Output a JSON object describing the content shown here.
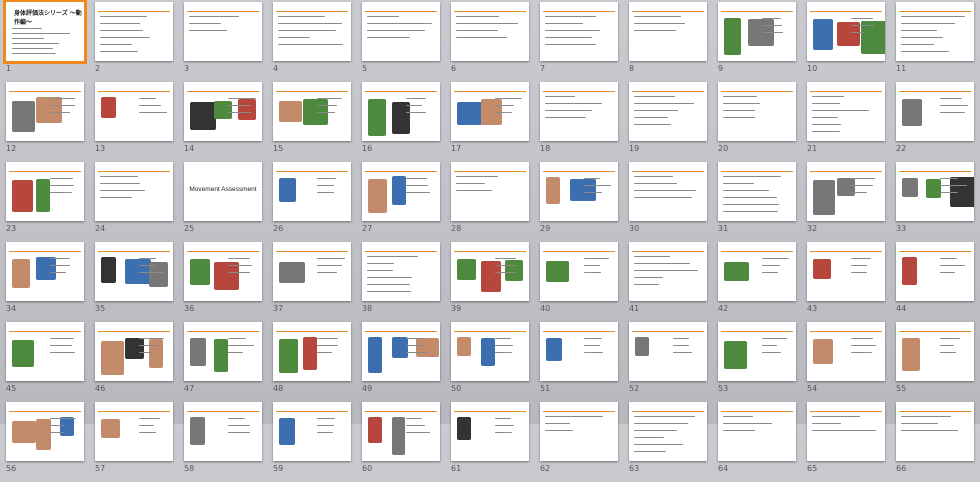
{
  "app": {
    "view": "Slide Sorter"
  },
  "selected_index": 0,
  "slides": [
    {
      "n": "1",
      "title": "身体評価法シリーズ ～動作編～",
      "kind": "cover"
    },
    {
      "n": "2",
      "title": "",
      "kind": "text"
    },
    {
      "n": "3",
      "title": "",
      "kind": "text"
    },
    {
      "n": "4",
      "title": "",
      "kind": "text"
    },
    {
      "n": "5",
      "title": "",
      "kind": "text"
    },
    {
      "n": "6",
      "title": "",
      "kind": "text"
    },
    {
      "n": "7",
      "title": "",
      "kind": "text"
    },
    {
      "n": "8",
      "title": "",
      "kind": "text"
    },
    {
      "n": "9",
      "title": "",
      "kind": "photo"
    },
    {
      "n": "10",
      "title": "",
      "kind": "photo"
    },
    {
      "n": "11",
      "title": "",
      "kind": "text"
    },
    {
      "n": "12",
      "title": "",
      "kind": "figure"
    },
    {
      "n": "13",
      "title": "",
      "kind": "figure"
    },
    {
      "n": "14",
      "title": "",
      "kind": "figure"
    },
    {
      "n": "15",
      "title": "",
      "kind": "figure"
    },
    {
      "n": "16",
      "title": "",
      "kind": "figure"
    },
    {
      "n": "17",
      "title": "",
      "kind": "figure"
    },
    {
      "n": "18",
      "title": "",
      "kind": "text"
    },
    {
      "n": "19",
      "title": "",
      "kind": "text"
    },
    {
      "n": "20",
      "title": "",
      "kind": "text"
    },
    {
      "n": "21",
      "title": "",
      "kind": "text"
    },
    {
      "n": "22",
      "title": "",
      "kind": "photo"
    },
    {
      "n": "23",
      "title": "",
      "kind": "figure"
    },
    {
      "n": "24",
      "title": "",
      "kind": "text"
    },
    {
      "n": "25",
      "title": "Movement Assessment",
      "kind": "big"
    },
    {
      "n": "26",
      "title": "",
      "kind": "figure"
    },
    {
      "n": "27",
      "title": "",
      "kind": "photo"
    },
    {
      "n": "28",
      "title": "",
      "kind": "text"
    },
    {
      "n": "29",
      "title": "",
      "kind": "photo"
    },
    {
      "n": "30",
      "title": "",
      "kind": "text"
    },
    {
      "n": "31",
      "title": "",
      "kind": "text"
    },
    {
      "n": "32",
      "title": "",
      "kind": "figure"
    },
    {
      "n": "33",
      "title": "",
      "kind": "figure"
    },
    {
      "n": "34",
      "title": "",
      "kind": "figure"
    },
    {
      "n": "35",
      "title": "",
      "kind": "figure"
    },
    {
      "n": "36",
      "title": "",
      "kind": "figure"
    },
    {
      "n": "37",
      "title": "",
      "kind": "figure"
    },
    {
      "n": "38",
      "title": "",
      "kind": "text"
    },
    {
      "n": "39",
      "title": "",
      "kind": "photo"
    },
    {
      "n": "40",
      "title": "",
      "kind": "photo"
    },
    {
      "n": "41",
      "title": "",
      "kind": "text"
    },
    {
      "n": "42",
      "title": "",
      "kind": "photo"
    },
    {
      "n": "43",
      "title": "",
      "kind": "photo"
    },
    {
      "n": "44",
      "title": "",
      "kind": "figure"
    },
    {
      "n": "45",
      "title": "",
      "kind": "photo"
    },
    {
      "n": "46",
      "title": "",
      "kind": "photo"
    },
    {
      "n": "47",
      "title": "",
      "kind": "photo"
    },
    {
      "n": "48",
      "title": "",
      "kind": "figure"
    },
    {
      "n": "49",
      "title": "",
      "kind": "photo"
    },
    {
      "n": "50",
      "title": "",
      "kind": "photo"
    },
    {
      "n": "51",
      "title": "",
      "kind": "photo"
    },
    {
      "n": "52",
      "title": "",
      "kind": "photo"
    },
    {
      "n": "53",
      "title": "",
      "kind": "photo"
    },
    {
      "n": "54",
      "title": "",
      "kind": "photo"
    },
    {
      "n": "55",
      "title": "",
      "kind": "photo"
    },
    {
      "n": "56",
      "title": "",
      "kind": "photo"
    },
    {
      "n": "57",
      "title": "",
      "kind": "photo"
    },
    {
      "n": "58",
      "title": "",
      "kind": "photo"
    },
    {
      "n": "59",
      "title": "",
      "kind": "photo"
    },
    {
      "n": "60",
      "title": "",
      "kind": "photo"
    },
    {
      "n": "61",
      "title": "",
      "kind": "photo"
    },
    {
      "n": "62",
      "title": "",
      "kind": "text"
    },
    {
      "n": "63",
      "title": "",
      "kind": "text"
    },
    {
      "n": "64",
      "title": "",
      "kind": "text"
    },
    {
      "n": "65",
      "title": "",
      "kind": "text"
    },
    {
      "n": "66",
      "title": "",
      "kind": "text"
    }
  ],
  "colors": {
    "selection": "#f08a1c",
    "background": "#bfc1c6",
    "title_rule": "#e88b2e"
  }
}
